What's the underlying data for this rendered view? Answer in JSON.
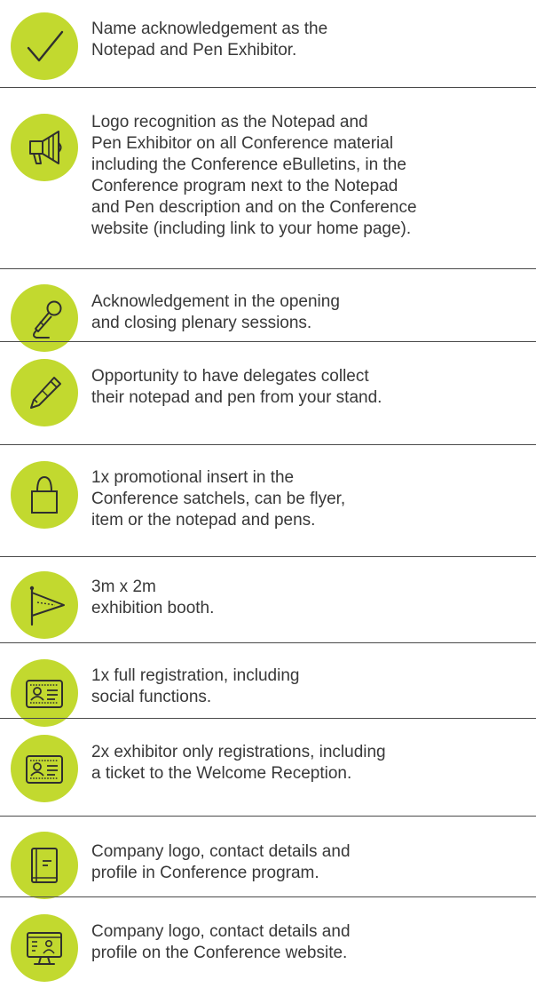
{
  "colors": {
    "icon_circle": "#c2d92f",
    "icon_line": "#2f2f2f",
    "text": "#383838",
    "divider": "#4a4a4a"
  },
  "items": [
    {
      "icon": "checkmark-icon",
      "lines": [
        "Name acknowledgement as the",
        "Notepad and Pen Exhibitor."
      ]
    },
    {
      "icon": "megaphone-icon",
      "lines": [
        "Logo recognition as the Notepad and",
        "Pen Exhibitor on all Conference material",
        "including the Conference eBulletins, in the",
        "Conference program next to the Notepad",
        "and Pen description and on the Conference",
        "website (including link to your home page)."
      ]
    },
    {
      "icon": "microphone-icon",
      "lines": [
        "Acknowledgement in the opening",
        "and closing plenary sessions."
      ]
    },
    {
      "icon": "pen-icon",
      "lines": [
        "Opportunity to have delegates collect",
        "their notepad and pen from your stand."
      ]
    },
    {
      "icon": "tote-bag-icon",
      "lines": [
        "1x promotional insert in the",
        "Conference satchels, can be flyer,",
        "item or the notepad and pens."
      ]
    },
    {
      "icon": "pennant-flag-icon",
      "lines": [
        "3m x 2m",
        "exhibition booth."
      ]
    },
    {
      "icon": "id-card-icon",
      "lines": [
        "1x full registration, including",
        "social functions."
      ]
    },
    {
      "icon": "id-card-icon",
      "lines": [
        "2x exhibitor only registrations, including",
        "a ticket to the Welcome Reception."
      ]
    },
    {
      "icon": "booklet-icon",
      "lines": [
        "Company logo, contact details and",
        "profile in Conference program."
      ]
    },
    {
      "icon": "monitor-profile-icon",
      "lines": [
        "Company logo, contact details and",
        "profile on the Conference website."
      ]
    }
  ]
}
